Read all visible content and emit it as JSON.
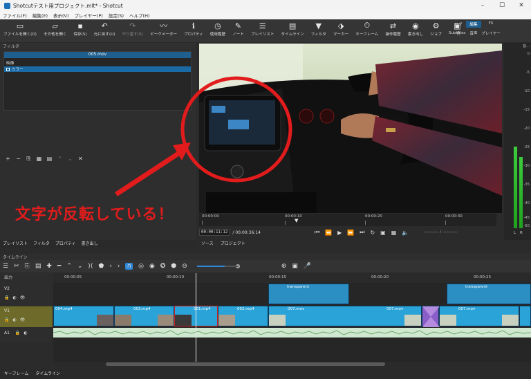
{
  "window": {
    "title": "Shotcutテスト用プロジェクト.mlt* - Shotcut"
  },
  "menu": [
    "ファイル(F)",
    "編集(E)",
    "表示(V)",
    "プレイヤー(P)",
    "設定(S)",
    "ヘルプ(H)"
  ],
  "toolbar": [
    {
      "label": "ファイルを開く(O)",
      "icon": "folder-icon"
    },
    {
      "label": "その他を開く",
      "icon": "open-other-icon"
    },
    {
      "label": "保存(S)",
      "icon": "save-icon"
    },
    {
      "label": "元に戻す(U)",
      "icon": "undo-icon"
    },
    {
      "label": "やり直す(R)",
      "icon": "redo-icon"
    },
    {
      "label": "ピークメーター",
      "icon": "peak-meter-icon"
    },
    {
      "label": "プロパティ",
      "icon": "info-icon"
    },
    {
      "label": "使用履歴",
      "icon": "history-icon"
    },
    {
      "label": "ノート",
      "icon": "notes-icon"
    },
    {
      "label": "プレイリスト",
      "icon": "playlist-icon"
    },
    {
      "label": "タイムライン",
      "icon": "timeline-icon"
    },
    {
      "label": "フィルタ",
      "icon": "filter-icon"
    },
    {
      "label": "マーカー",
      "icon": "marker-icon"
    },
    {
      "label": "キーフレーム",
      "icon": "keyframe-icon"
    },
    {
      "label": "操作履歴",
      "icon": "job-history-icon"
    },
    {
      "label": "書き出し",
      "icon": "export-icon"
    },
    {
      "label": "ジョブ",
      "icon": "jobs-icon"
    },
    {
      "label": "Subtitles",
      "icon": "subtitles-icon"
    }
  ],
  "layouts": {
    "row1": [
      "ログ",
      "編集",
      "FX"
    ],
    "row2": [
      "色",
      "音声",
      "プレイヤー"
    ],
    "active": "編集"
  },
  "filters": {
    "panel_title": "フィルタ",
    "clip_name": "005.mov",
    "category": "映像",
    "items": [
      "ミラー"
    ]
  },
  "left_tabs": [
    "プレイリスト",
    "フィルタ",
    "プロパティ",
    "書き出し"
  ],
  "player": {
    "ruler_ticks": [
      "00:00:00",
      "00:00:10",
      "00:00:20",
      "00:00:30"
    ],
    "current_time": "00:00:11:12",
    "total_time": "/ 00:00:36:14",
    "in_out": "--:--:--:-- / --:--:--:--"
  },
  "source_tabs": [
    "ソース",
    "プロジェクト"
  ],
  "meter": {
    "title": "音...",
    "labels": [
      "0",
      "-5",
      "-10",
      "-15",
      "-20",
      "-25",
      "-30",
      "-35",
      "-40",
      "-45",
      "-50"
    ],
    "channels": [
      "L",
      "R"
    ]
  },
  "timeline": {
    "panel_title": "タイムライン",
    "output_label": "出力",
    "ruler": [
      "00:00:05",
      "00:00:10",
      "00:00:15",
      "00:00:20",
      "00:00:25"
    ],
    "tracks": [
      "V2",
      "V1",
      "A1"
    ],
    "v2_clips": [
      "transparent",
      "transparent"
    ],
    "v1_clips": [
      "004.mp4",
      "003.mp4",
      "001.mp4",
      "002.mp4",
      "007.mov",
      "007.mov",
      "007.mov"
    ]
  },
  "bottom_tabs": [
    "キーフレーム",
    "タイムライン"
  ],
  "annotation": {
    "text": "文字が反転している！",
    "color": "#e21c1c"
  }
}
